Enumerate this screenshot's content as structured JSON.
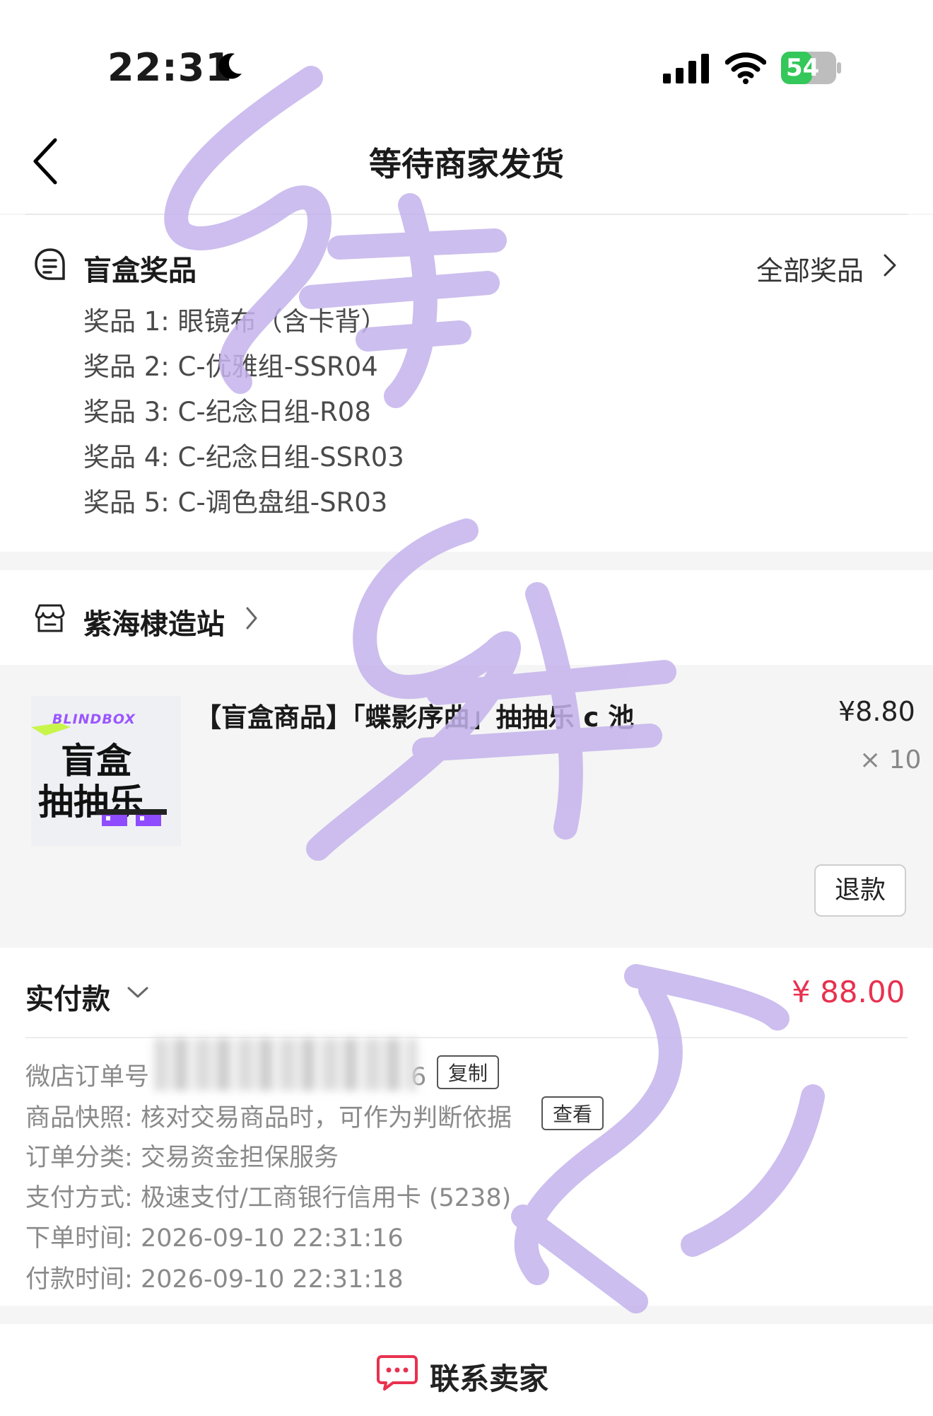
{
  "status_bar": {
    "time": "22:31",
    "battery": "54"
  },
  "nav": {
    "title": "等待商家发货"
  },
  "prizes": {
    "title": "盲盒奖品",
    "all_label": "全部奖品",
    "items": [
      "奖品 1: 眼镜布（含卡背）",
      "奖品 2: C-优雅组-SSR04",
      "奖品 3: C-纪念日组-R08",
      "奖品 4: C-纪念日组-SSR03",
      "奖品 5: C-调色盘组-SR03"
    ]
  },
  "shop": {
    "name": "紫海棣造站"
  },
  "product": {
    "title": "【盲盒商品】「蝶影序曲」抽抽乐 c 池",
    "price": "¥8.80",
    "quantity": "× 10",
    "thumb_brand": "BLINDBOX",
    "thumb_line1": "盲盒",
    "thumb_line2": "抽抽乐",
    "refund_label": "退款"
  },
  "payment": {
    "label": "实付款",
    "amount": "¥ 88.00"
  },
  "order_info": {
    "order_no_label": "微店订单号",
    "order_no_suffix": "6",
    "copy_label": "复制",
    "snapshot_label": "商品快照:",
    "snapshot_text": "核对交易商品时，可作为判断依据",
    "view_label": "查看",
    "category_label": "订单分类:",
    "category_value": "交易资金担保服务",
    "pay_method_label": "支付方式:",
    "pay_method_value": "极速支付/工商银行信用卡 (5238)",
    "order_time_label": "下单时间:",
    "order_time_value": "2026-09-10 22:31:16",
    "pay_time_label": "付款时间:",
    "pay_time_value": "2026-09-10 22:31:18"
  },
  "bottom": {
    "contact_label": "联系卖家"
  },
  "colors": {
    "price_red": "#e8314f",
    "watermark": "#c4b3ec",
    "battery_green": "#34c759"
  }
}
